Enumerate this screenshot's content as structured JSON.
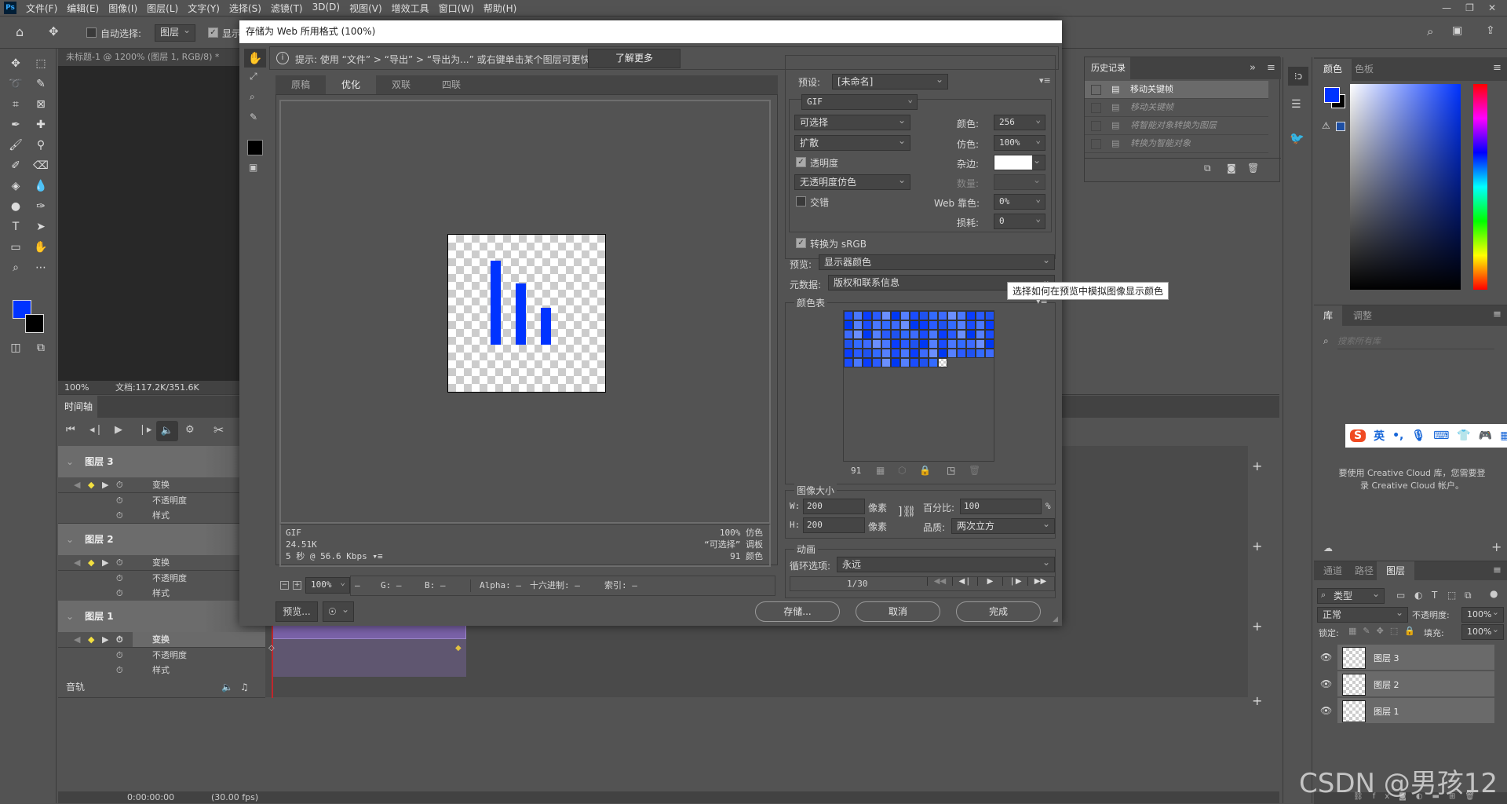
{
  "app": {
    "logo": "Ps",
    "menu": [
      "文件(F)",
      "编辑(E)",
      "图像(I)",
      "图层(L)",
      "文字(Y)",
      "选择(S)",
      "滤镜(T)",
      "3D(D)",
      "视图(V)",
      "增效工具",
      "窗口(W)",
      "帮助(H)"
    ]
  },
  "options": {
    "auto_select_label": "自动选择:",
    "auto_select_value": "图层",
    "show_label": "显示"
  },
  "document": {
    "tab_title": "未标题-1 @ 1200% (图层 1, RGB/8) *",
    "zoom": "100%",
    "doc_info": "文档:117.2K/351.6K"
  },
  "timeline": {
    "tab": "时间轴",
    "layers": [
      {
        "name": "图层 3",
        "props": [
          "变换",
          "不透明度",
          "样式"
        ]
      },
      {
        "name": "图层 2",
        "props": [
          "变换",
          "不透明度",
          "样式"
        ]
      },
      {
        "name": "图层 1",
        "props": [
          "变换",
          "不透明度",
          "样式"
        ]
      }
    ],
    "audio": "音轨",
    "timecode": "0:00:00:00",
    "fps": "(30.00 fps)"
  },
  "dialog": {
    "title": "存储为 Web 所用格式 (100%)",
    "hint": "提示: 使用 “文件” > “导出” > “导出为...” 或右键单击某个图层可更快速地导出资源",
    "learn_more": "了解更多",
    "tabs": [
      "原稿",
      "优化",
      "双联",
      "四联"
    ],
    "active_tab": 1,
    "info_left": [
      "GIF",
      "24.51K",
      "5 秒 @ 56.6 Kbps"
    ],
    "info_right": [
      "100% 仿色",
      "“可选择” 调板",
      "91 颜色"
    ],
    "zoom": "100%",
    "readout": {
      "r": "—",
      "g": "G: —",
      "b": "B: —",
      "alpha": "Alpha: —",
      "hex": "十六进制: —",
      "index": "索引: —"
    },
    "preview_btn": "预览...",
    "save_btn": "存储...",
    "cancel_btn": "取消",
    "done_btn": "完成",
    "settings": {
      "preset_label": "预设:",
      "preset": "[未命名]",
      "format": "GIF",
      "reduction": "可选择",
      "dither_algo": "扩散",
      "transparency": "透明度",
      "transparency_checked": true,
      "trans_dither": "无透明度仿色",
      "interlaced": "交错",
      "interlaced_checked": false,
      "colors_label": "颜色:",
      "colors": "256",
      "dither_label": "仿色:",
      "dither": "100%",
      "matte_label": "杂边:",
      "matte_color": "#ffffff",
      "amount_label": "数量:",
      "amount": "",
      "web_snap_label": "Web 靠色:",
      "web_snap": "0%",
      "lossy_label": "损耗:",
      "lossy": "0",
      "convert_srgb": "转换为 sRGB",
      "convert_srgb_checked": true,
      "preview_label": "预览:",
      "preview": "显示器颜色",
      "metadata_label": "元数据:",
      "metadata": "版权和联系信息",
      "tooltip": "选择如何在预览中模拟图像显示颜色",
      "color_table_label": "颜色表",
      "color_count": "91",
      "image_size_label": "图像大小",
      "w_label": "W:",
      "w": "200",
      "h_label": "H:",
      "h": "200",
      "px": "像素",
      "percent_label": "百分比:",
      "percent": "100",
      "percent_unit": "%",
      "quality_label": "品质:",
      "quality": "两次立方",
      "animation_label": "动画",
      "loop_label": "循环选项:",
      "loop": "永远",
      "frame": "1/30"
    }
  },
  "history": {
    "tab": "历史记录",
    "items": [
      {
        "label": "移动关键帧",
        "active": true
      },
      {
        "label": "移动关键帧"
      },
      {
        "label": "将智能对象转换为图层"
      },
      {
        "label": "转换为智能对象"
      }
    ]
  },
  "color": {
    "tabs": [
      "颜色",
      "色板"
    ],
    "fg": "#0033ff",
    "bg": "#000000"
  },
  "library": {
    "tabs": [
      "库",
      "调整"
    ],
    "search_placeholder": "搜索所有库",
    "message": "要使用 Creative Cloud 库，您需要登录 Creative Cloud 帐户。"
  },
  "ime": {
    "lang": "英"
  },
  "layers": {
    "tabs": [
      "通道",
      "路径",
      "图层"
    ],
    "filter": "类型",
    "blend": "正常",
    "opacity_label": "不透明度:",
    "opacity": "100%",
    "lock_label": "锁定:",
    "fill_label": "填充:",
    "fill": "100%",
    "items": [
      "图层 3",
      "图层 2",
      "图层 1"
    ]
  },
  "watermark": "CSDN @男孩12"
}
